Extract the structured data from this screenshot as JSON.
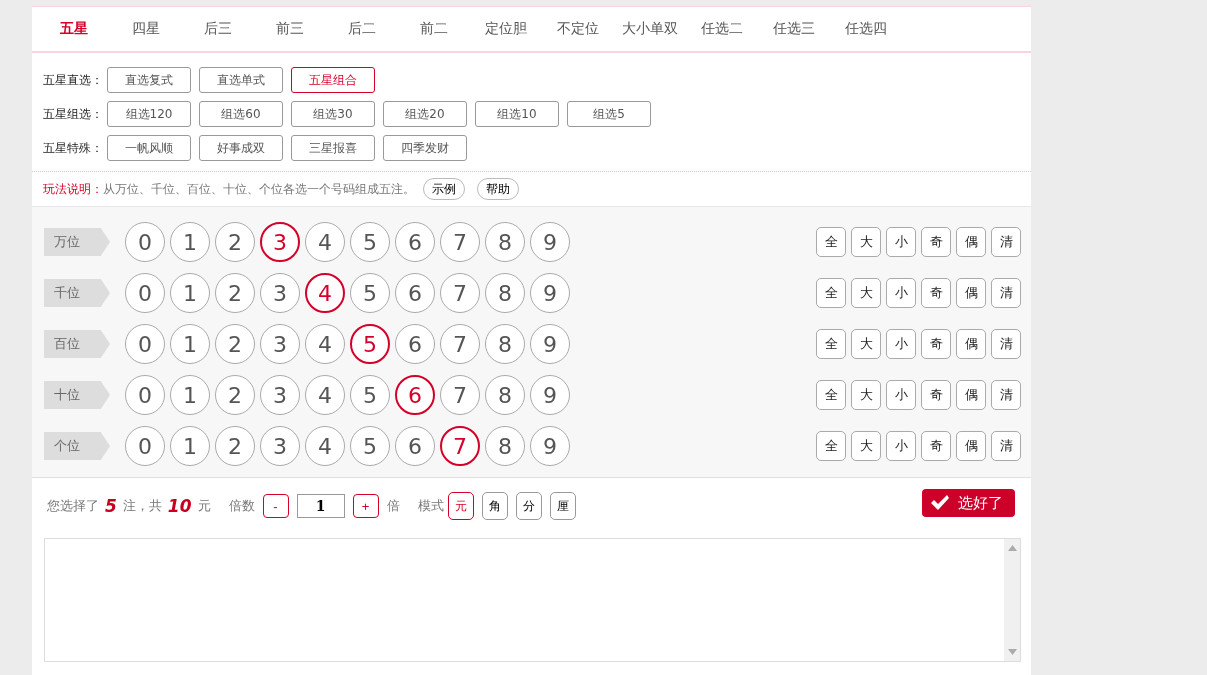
{
  "tabs": [
    {
      "label": "五星",
      "selected": true
    },
    {
      "label": "四星",
      "selected": false
    },
    {
      "label": "后三",
      "selected": false
    },
    {
      "label": "前三",
      "selected": false
    },
    {
      "label": "后二",
      "selected": false
    },
    {
      "label": "前二",
      "selected": false
    },
    {
      "label": "定位胆",
      "selected": false
    },
    {
      "label": "不定位",
      "selected": false
    },
    {
      "label": "大小单双",
      "selected": false
    },
    {
      "label": "任选二",
      "selected": false
    },
    {
      "label": "任选三",
      "selected": false
    },
    {
      "label": "任选四",
      "selected": false
    }
  ],
  "groups": [
    {
      "label": "五星直选：",
      "options": [
        {
          "label": "直选复式",
          "selected": false
        },
        {
          "label": "直选单式",
          "selected": false
        },
        {
          "label": "五星组合",
          "selected": true
        }
      ]
    },
    {
      "label": "五星组选：",
      "options": [
        {
          "label": "组选120",
          "selected": false
        },
        {
          "label": "组选60",
          "selected": false
        },
        {
          "label": "组选30",
          "selected": false
        },
        {
          "label": "组选20",
          "selected": false
        },
        {
          "label": "组选10",
          "selected": false
        },
        {
          "label": "组选5",
          "selected": false
        }
      ]
    },
    {
      "label": "五星特殊：",
      "options": [
        {
          "label": "一帆风顺",
          "selected": false
        },
        {
          "label": "好事成双",
          "selected": false
        },
        {
          "label": "三星报喜",
          "selected": false
        },
        {
          "label": "四季发财",
          "selected": false
        }
      ]
    }
  ],
  "help": {
    "label": "玩法说明：",
    "text": "从万位、千位、百位、十位、个位各选一个号码组成五注。",
    "buttons": [
      "示例",
      "帮助"
    ]
  },
  "rows": [
    {
      "label": "万位",
      "digits": [
        {
          "label": "0",
          "selected": false
        },
        {
          "label": "1",
          "selected": false
        },
        {
          "label": "2",
          "selected": false
        },
        {
          "label": "3",
          "selected": true
        },
        {
          "label": "4",
          "selected": false
        },
        {
          "label": "5",
          "selected": false
        },
        {
          "label": "6",
          "selected": false
        },
        {
          "label": "7",
          "selected": false
        },
        {
          "label": "8",
          "selected": false
        },
        {
          "label": "9",
          "selected": false
        }
      ],
      "filters": [
        "全",
        "大",
        "小",
        "奇",
        "偶",
        "清"
      ]
    },
    {
      "label": "千位",
      "digits": [
        {
          "label": "0",
          "selected": false
        },
        {
          "label": "1",
          "selected": false
        },
        {
          "label": "2",
          "selected": false
        },
        {
          "label": "3",
          "selected": false
        },
        {
          "label": "4",
          "selected": true
        },
        {
          "label": "5",
          "selected": false
        },
        {
          "label": "6",
          "selected": false
        },
        {
          "label": "7",
          "selected": false
        },
        {
          "label": "8",
          "selected": false
        },
        {
          "label": "9",
          "selected": false
        }
      ],
      "filters": [
        "全",
        "大",
        "小",
        "奇",
        "偶",
        "清"
      ]
    },
    {
      "label": "百位",
      "digits": [
        {
          "label": "0",
          "selected": false
        },
        {
          "label": "1",
          "selected": false
        },
        {
          "label": "2",
          "selected": false
        },
        {
          "label": "3",
          "selected": false
        },
        {
          "label": "4",
          "selected": false
        },
        {
          "label": "5",
          "selected": true
        },
        {
          "label": "6",
          "selected": false
        },
        {
          "label": "7",
          "selected": false
        },
        {
          "label": "8",
          "selected": false
        },
        {
          "label": "9",
          "selected": false
        }
      ],
      "filters": [
        "全",
        "大",
        "小",
        "奇",
        "偶",
        "清"
      ]
    },
    {
      "label": "十位",
      "digits": [
        {
          "label": "0",
          "selected": false
        },
        {
          "label": "1",
          "selected": false
        },
        {
          "label": "2",
          "selected": false
        },
        {
          "label": "3",
          "selected": false
        },
        {
          "label": "4",
          "selected": false
        },
        {
          "label": "5",
          "selected": false
        },
        {
          "label": "6",
          "selected": true
        },
        {
          "label": "7",
          "selected": false
        },
        {
          "label": "8",
          "selected": false
        },
        {
          "label": "9",
          "selected": false
        }
      ],
      "filters": [
        "全",
        "大",
        "小",
        "奇",
        "偶",
        "清"
      ]
    },
    {
      "label": "个位",
      "digits": [
        {
          "label": "0",
          "selected": false
        },
        {
          "label": "1",
          "selected": false
        },
        {
          "label": "2",
          "selected": false
        },
        {
          "label": "3",
          "selected": false
        },
        {
          "label": "4",
          "selected": false
        },
        {
          "label": "5",
          "selected": false
        },
        {
          "label": "6",
          "selected": false
        },
        {
          "label": "7",
          "selected": true
        },
        {
          "label": "8",
          "selected": false
        },
        {
          "label": "9",
          "selected": false
        }
      ],
      "filters": [
        "全",
        "大",
        "小",
        "奇",
        "偶",
        "清"
      ]
    }
  ],
  "summary": {
    "prefix": "您选择了",
    "count": "5",
    "middle": "注，共",
    "amount": "10",
    "suffix": "元",
    "multiplier_label": "倍数",
    "minus": "-",
    "multiplier": "1",
    "plus": "+",
    "multiplier_unit": "倍",
    "mode_label": "模式",
    "modes": [
      {
        "label": "元",
        "selected": true
      },
      {
        "label": "角",
        "selected": false
      },
      {
        "label": "分",
        "selected": false
      },
      {
        "label": "厘",
        "selected": false
      }
    ],
    "confirm": "选好了"
  }
}
